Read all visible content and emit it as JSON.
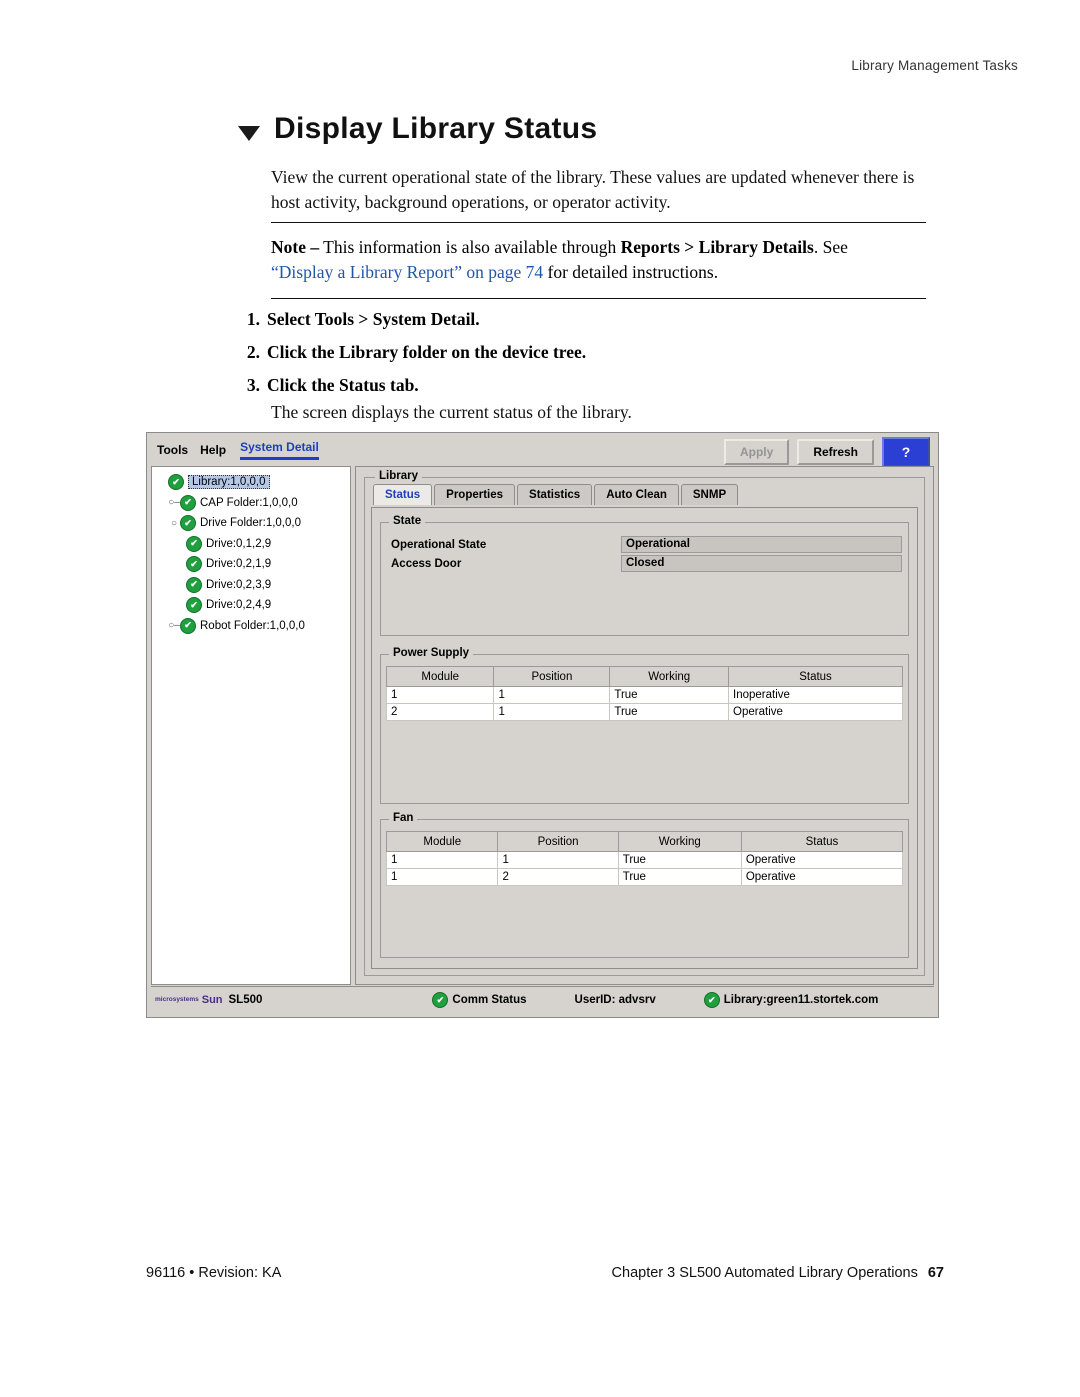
{
  "running_head": "Library Management Tasks",
  "heading": "Display Library Status",
  "intro": "View the current operational state of the library. These values are updated whenever there is host activity, background operations, or operator activity.",
  "note": {
    "lead": "Note –",
    "text_1": "This information is also available through ",
    "bold_1": "Reports > Library Details",
    "text_2": ". See ",
    "link": "“Display a Library Report” on page 74",
    "text_3": " for detailed instructions."
  },
  "steps": [
    {
      "num": "1.",
      "text": "Select Tools > System Detail."
    },
    {
      "num": "2.",
      "text": "Click the Library folder on the device tree."
    },
    {
      "num": "3.",
      "text": "Click the Status tab."
    }
  ],
  "after_steps": "The screen displays the current status of the library.",
  "app": {
    "menus": [
      "Tools",
      "Help"
    ],
    "active_menu": "System Detail",
    "buttons": {
      "apply": "Apply",
      "refresh": "Refresh",
      "help": "?"
    },
    "tree": [
      {
        "label": "Library:1,0,0,0",
        "indent": 0,
        "handle": "",
        "selected": true
      },
      {
        "label": "CAP Folder:1,0,0,0",
        "indent": 1,
        "handle": "○–",
        "selected": false
      },
      {
        "label": "Drive Folder:1,0,0,0",
        "indent": 1,
        "handle": "○",
        "selected": false
      },
      {
        "label": "Drive:0,1,2,9",
        "indent": 2,
        "handle": "",
        "selected": false
      },
      {
        "label": "Drive:0,2,1,9",
        "indent": 2,
        "handle": "",
        "selected": false
      },
      {
        "label": "Drive:0,2,3,9",
        "indent": 2,
        "handle": "",
        "selected": false
      },
      {
        "label": "Drive:0,2,4,9",
        "indent": 2,
        "handle": "",
        "selected": false
      },
      {
        "label": "Robot Folder:1,0,0,0",
        "indent": 1,
        "handle": "○–",
        "selected": false
      }
    ],
    "group_title": "Library",
    "tabs": [
      {
        "label": "Status",
        "active": true
      },
      {
        "label": "Properties",
        "active": false
      },
      {
        "label": "Statistics",
        "active": false
      },
      {
        "label": "Auto Clean",
        "active": false
      },
      {
        "label": "SNMP",
        "active": false
      }
    ],
    "state": {
      "title": "State",
      "rows": [
        {
          "key": "Operational State",
          "value": "Operational"
        },
        {
          "key": "Access Door",
          "value": "Closed"
        }
      ]
    },
    "power_supply": {
      "title": "Power Supply",
      "columns": [
        "Module",
        "Position",
        "Working",
        "Status"
      ],
      "rows": [
        [
          "1",
          "1",
          "True",
          "Inoperative"
        ],
        [
          "2",
          "1",
          "True",
          "Operative"
        ]
      ]
    },
    "fan": {
      "title": "Fan",
      "columns": [
        "Module",
        "Position",
        "Working",
        "Status"
      ],
      "rows": [
        [
          "1",
          "1",
          "True",
          "Operative"
        ],
        [
          "1",
          "2",
          "True",
          "Operative"
        ]
      ]
    },
    "statusbar": {
      "logo_top": "microsystems",
      "logo_text": "Sun",
      "model": "SL500",
      "comm_status": "Comm Status",
      "userid": "UserID: advsrv",
      "library": "Library:green11.stortek.com"
    }
  },
  "footer": {
    "left": "96116  •  Revision: KA",
    "right": "Chapter 3 SL500 Automated Library Operations",
    "page": "67"
  }
}
